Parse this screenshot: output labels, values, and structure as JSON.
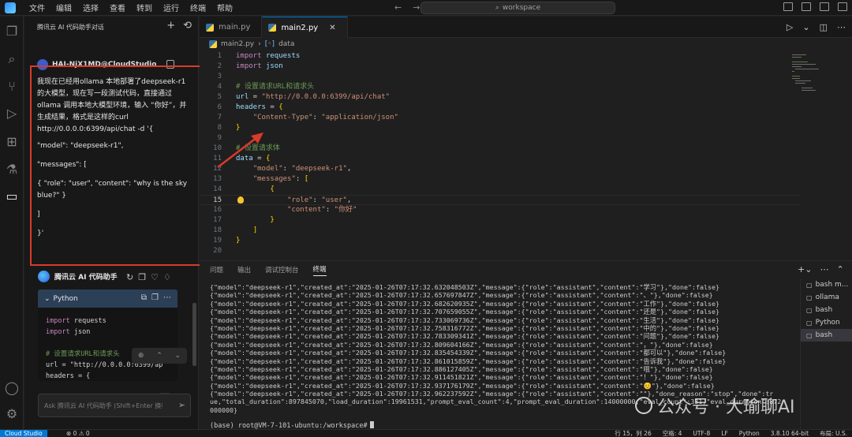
{
  "titlebar": {
    "menu": [
      "文件",
      "编辑",
      "选择",
      "查看",
      "转到",
      "运行",
      "终端",
      "帮助"
    ],
    "search": "workspace",
    "back_arrow": "←",
    "forward_arrow": "→"
  },
  "activity_icons": [
    "files-icon",
    "search-icon",
    "source-control-icon",
    "run-debug-icon",
    "extensions-icon",
    "testing-icon",
    "chat-icon",
    "account-icon",
    "settings-icon"
  ],
  "chat": {
    "title": "腾讯云 AI 代码助手对话",
    "user_name": "HAI-NjX1MD@CloudStudio",
    "message": [
      "我现在已经用ollama 本地部署了deepseek-r1的大模型，现在写一段测试代码，直接通过ollama 调用本地大模型环境，输入 “你好”，并生成结果，格式是这样的curl http://0.0.0.0:6399/api/chat -d '{",
      "\"model\": \"deepseek-r1\",",
      "\"messages\": [",
      "{ \"role\": \"user\", \"content\": \"why is the sky blue?\" }",
      "]",
      "}'"
    ],
    "assistant_name": "腾讯云 AI 代码助手",
    "code_card": {
      "language": "Python",
      "lines": [
        "import requests",
        "import json",
        "",
        "# 设置请求URL和请求头",
        "url = \"http://0.0.0.0:6399/ap",
        "headers = {"
      ]
    },
    "input_placeholder": "Ask 腾讯云 AI 代码助手 (Shift+Enter 换行)"
  },
  "editor": {
    "tabs": [
      {
        "label": "main.py",
        "active": false
      },
      {
        "label": "main2.py",
        "active": true
      }
    ],
    "breadcrumb": [
      "main2.py",
      "data"
    ],
    "lines": [
      {
        "n": "1",
        "text": "import requests"
      },
      {
        "n": "2",
        "text": "import json"
      },
      {
        "n": "3",
        "text": ""
      },
      {
        "n": "4",
        "text": "# 设置请求URL和请求头"
      },
      {
        "n": "5",
        "text": "url = \"http://0.0.0.0:6399/api/chat\""
      },
      {
        "n": "6",
        "text": "headers = {"
      },
      {
        "n": "7",
        "text": "    \"Content-Type\": \"application/json\""
      },
      {
        "n": "8",
        "text": "}"
      },
      {
        "n": "9",
        "text": ""
      },
      {
        "n": "10",
        "text": "# 设置请求体"
      },
      {
        "n": "11",
        "text": "data = {"
      },
      {
        "n": "12",
        "text": "    \"model\": \"deepseek-r1\","
      },
      {
        "n": "13",
        "text": "    \"messages\": ["
      },
      {
        "n": "14",
        "text": "        {"
      },
      {
        "n": "15",
        "text": "            \"role\": \"user\","
      },
      {
        "n": "16",
        "text": "            \"content\": \"你好\""
      },
      {
        "n": "17",
        "text": "        }"
      },
      {
        "n": "18",
        "text": "    ]"
      },
      {
        "n": "19",
        "text": "}"
      },
      {
        "n": "20",
        "text": ""
      }
    ]
  },
  "panel": {
    "tabs": [
      "问题",
      "输出",
      "调试控制台",
      "终端"
    ],
    "active_tab": "终端",
    "terminal_lines": [
      "{\"model\":\"deepseek-r1\",\"created_at\":\"2025-01-26T07:17:32.632048503Z\",\"message\":{\"role\":\"assistant\",\"content\":\"学习\"},\"done\":false}",
      "{\"model\":\"deepseek-r1\",\"created_at\":\"2025-01-26T07:17:32.657697847Z\",\"message\":{\"role\":\"assistant\",\"content\":\"、\"},\"done\":false}",
      "{\"model\":\"deepseek-r1\",\"created_at\":\"2025-01-26T07:17:32.682620935Z\",\"message\":{\"role\":\"assistant\",\"content\":\"工作\"},\"done\":false}",
      "{\"model\":\"deepseek-r1\",\"created_at\":\"2025-01-26T07:17:32.707659055Z\",\"message\":{\"role\":\"assistant\",\"content\":\"还是\"},\"done\":false}",
      "{\"model\":\"deepseek-r1\",\"created_at\":\"2025-01-26T07:17:32.733069736Z\",\"message\":{\"role\":\"assistant\",\"content\":\"生活\"},\"done\":false}",
      "{\"model\":\"deepseek-r1\",\"created_at\":\"2025-01-26T07:17:32.758316772Z\",\"message\":{\"role\":\"assistant\",\"content\":\"中的\"},\"done\":false}",
      "{\"model\":\"deepseek-r1\",\"created_at\":\"2025-01-26T07:17:32.783309341Z\",\"message\":{\"role\":\"assistant\",\"content\":\"问题\"},\"done\":false}",
      "{\"model\":\"deepseek-r1\",\"created_at\":\"2025-01-26T07:17:32.809604166Z\",\"message\":{\"role\":\"assistant\",\"content\":\"，\"},\"done\":false}",
      "{\"model\":\"deepseek-r1\",\"created_at\":\"2025-01-26T07:17:32.835454339Z\",\"message\":{\"role\":\"assistant\",\"content\":\"都可以\"},\"done\":false}",
      "{\"model\":\"deepseek-r1\",\"created_at\":\"2025-01-26T07:17:32.861015859Z\",\"message\":{\"role\":\"assistant\",\"content\":\"告诉我\"},\"done\":false}",
      "{\"model\":\"deepseek-r1\",\"created_at\":\"2025-01-26T07:17:32.886127405Z\",\"message\":{\"role\":\"assistant\",\"content\":\"哦\"},\"done\":false}",
      "{\"model\":\"deepseek-r1\",\"created_at\":\"2025-01-26T07:17:32.911451821Z\",\"message\":{\"role\":\"assistant\",\"content\":\"！\"},\"done\":false}",
      "{\"model\":\"deepseek-r1\",\"created_at\":\"2025-01-26T07:17:32.937176179Z\",\"message\":{\"role\":\"assistant\",\"content\":\"😊\"},\"done\":false}",
      "{\"model\":\"deepseek-r1\",\"created_at\":\"2025-01-26T07:17:32.962237592Z\",\"message\":{\"role\":\"assistant\",\"content\":\"\"},\"done_reason\":\"stop\",\"done\":tr",
      "ue,\"total_duration\":897845070,\"load_duration\":19961531,\"prompt_eval_count\":4,\"prompt_eval_duration\":14000000,\"eval_count\":331,\"eval_duration\":872",
      "000000}"
    ],
    "prompt": "(base) root@VM-7-101-ubuntu:/workspace#",
    "terminals": [
      {
        "label": "bash m...",
        "active": false
      },
      {
        "label": "ollama",
        "active": false
      },
      {
        "label": "bash",
        "active": false
      },
      {
        "label": "Python",
        "active": false
      },
      {
        "label": "bash",
        "active": true
      }
    ]
  },
  "watermark": "公众号 · 大瑜聊AI",
  "statusbar": {
    "remote": "Cloud Studio",
    "errors": "⊗ 0 ⚠ 0",
    "right": [
      "行 15，列 26",
      "空格: 4",
      "UTF-8",
      "LF",
      "Python",
      "3.8.10 64-bit",
      "布局: U.S."
    ]
  },
  "colors": {
    "highlight_box": "#d93a2b",
    "accent": "#0078d4"
  }
}
